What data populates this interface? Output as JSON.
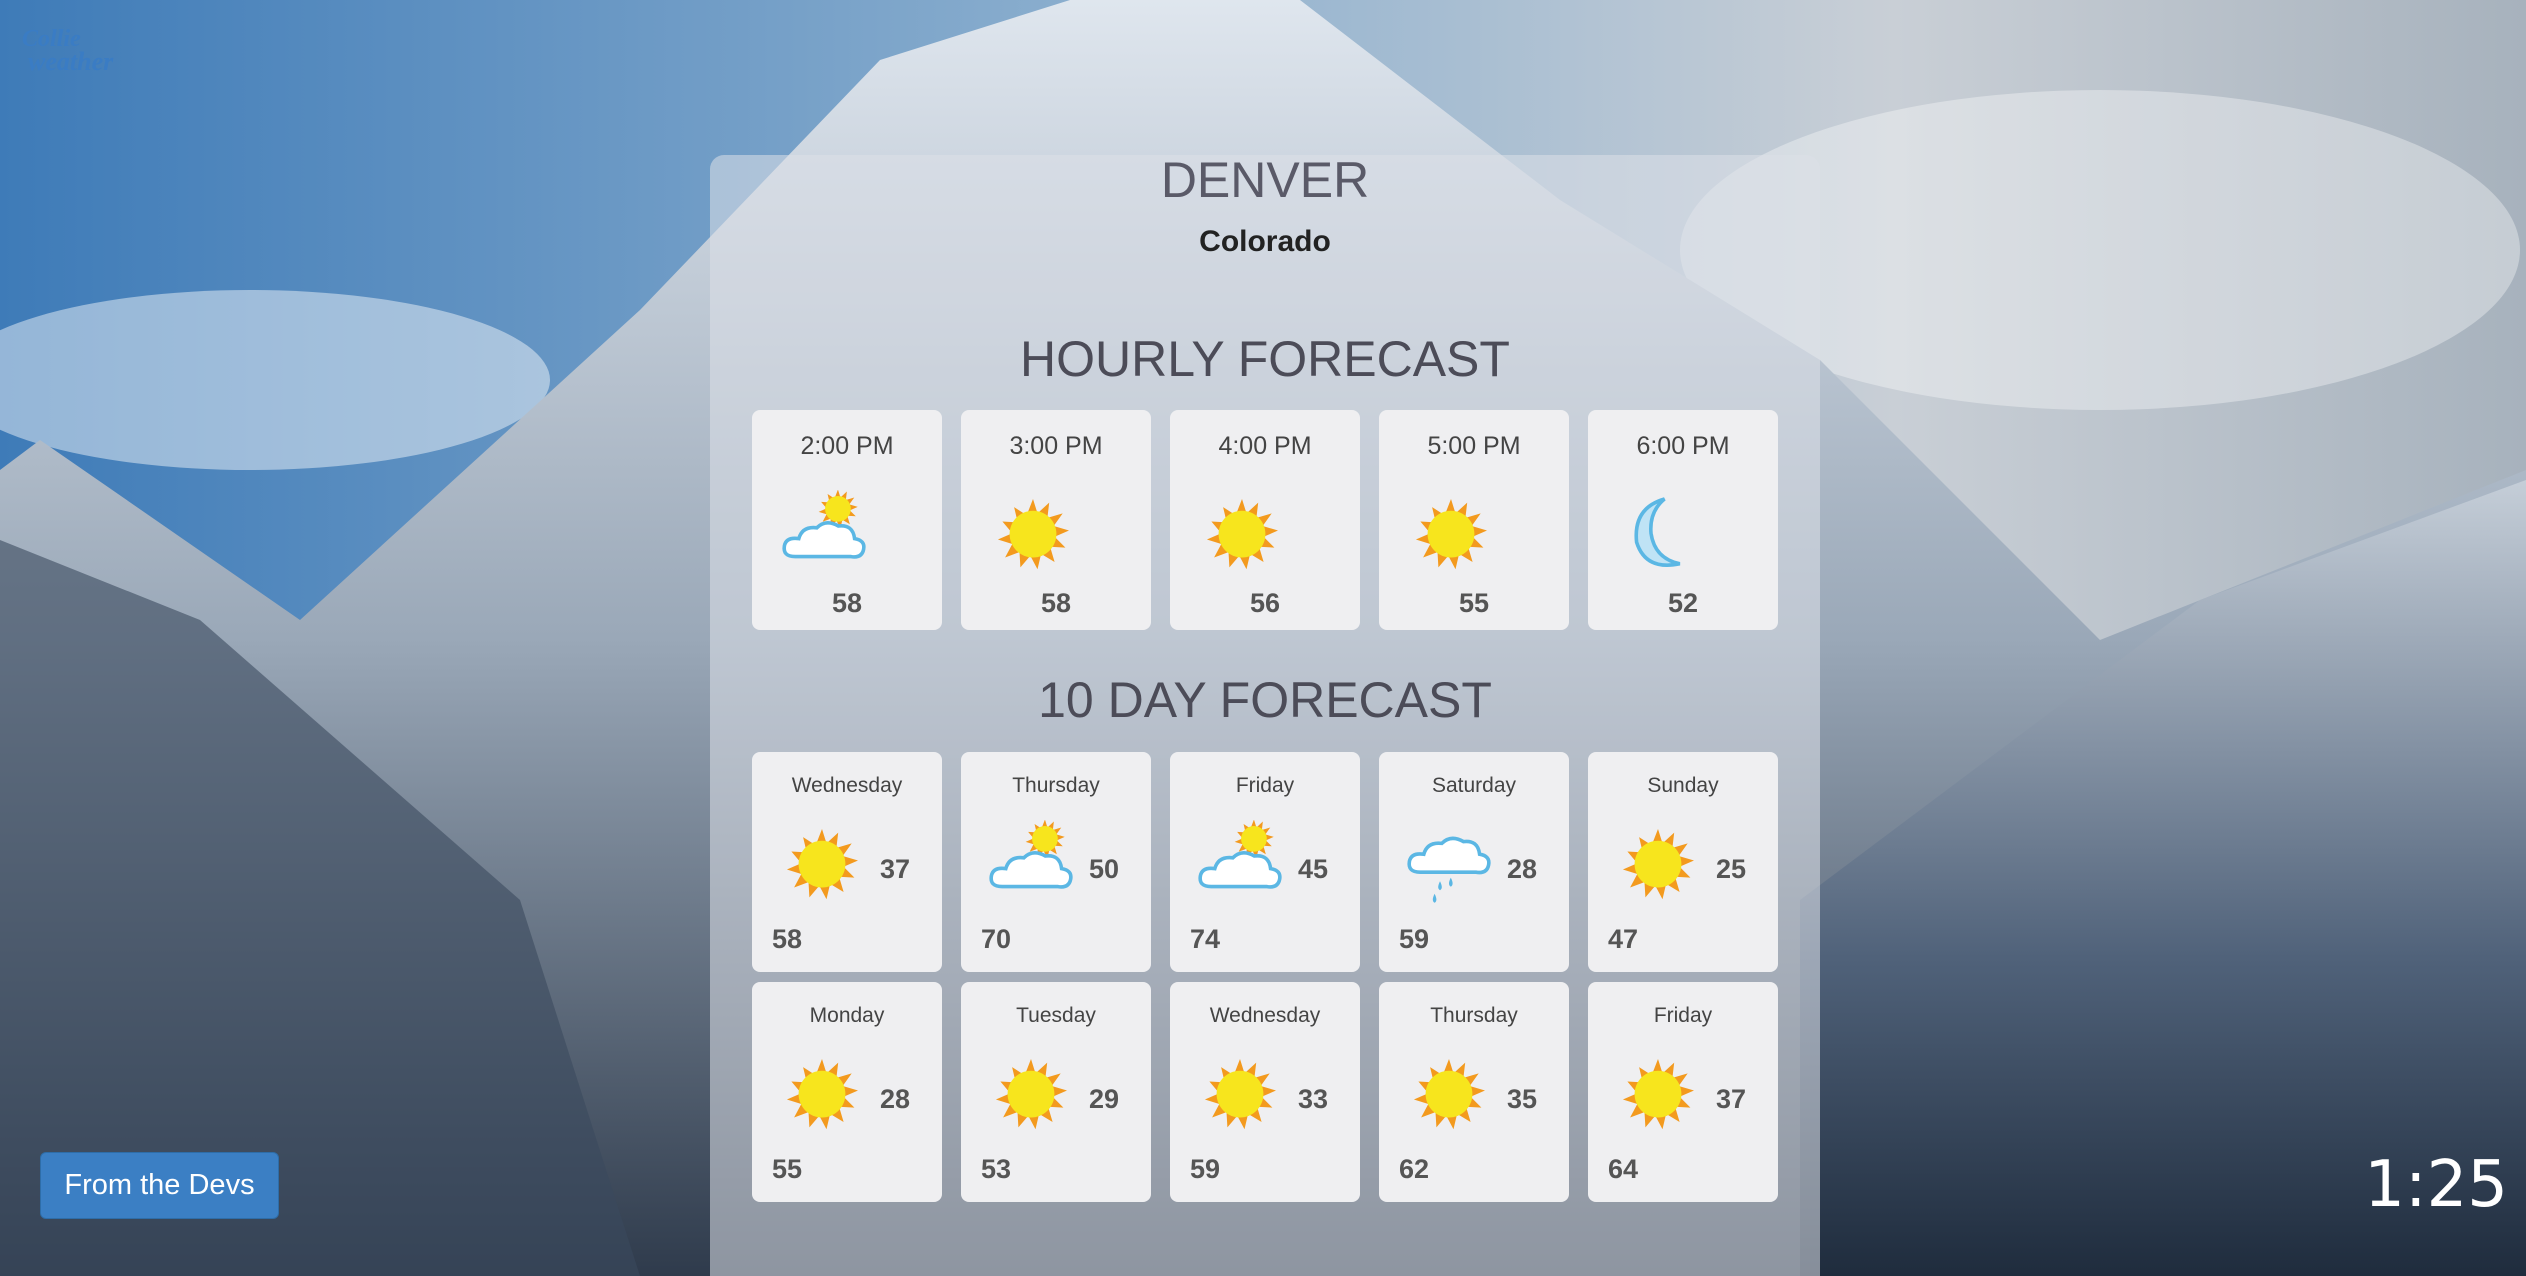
{
  "header": {
    "city": "DENVER",
    "region": "Colorado"
  },
  "hourly": {
    "title": "HOURLY FORECAST",
    "items": [
      {
        "time": "2:00 PM",
        "icon": "partly-cloudy-icon",
        "temp": "58"
      },
      {
        "time": "3:00 PM",
        "icon": "sun-icon",
        "temp": "58"
      },
      {
        "time": "4:00 PM",
        "icon": "sun-icon",
        "temp": "56"
      },
      {
        "time": "5:00 PM",
        "icon": "sun-icon",
        "temp": "55"
      },
      {
        "time": "6:00 PM",
        "icon": "moon-icon",
        "temp": "52"
      }
    ]
  },
  "ten_day": {
    "title": "10 DAY FORECAST",
    "days": [
      {
        "day": "Wednesday",
        "icon": "sun-icon",
        "high": "37",
        "low": "58"
      },
      {
        "day": "Thursday",
        "icon": "partly-cloudy-icon",
        "high": "50",
        "low": "70"
      },
      {
        "day": "Friday",
        "icon": "partly-cloudy-icon",
        "high": "45",
        "low": "74"
      },
      {
        "day": "Saturday",
        "icon": "rain-cloud-icon",
        "high": "28",
        "low": "59"
      },
      {
        "day": "Sunday",
        "icon": "sun-icon",
        "high": "25",
        "low": "47"
      },
      {
        "day": "Monday",
        "icon": "sun-icon",
        "high": "28",
        "low": "55"
      },
      {
        "day": "Tuesday",
        "icon": "sun-icon",
        "high": "29",
        "low": "53"
      },
      {
        "day": "Wednesday",
        "icon": "sun-icon",
        "high": "33",
        "low": "59"
      },
      {
        "day": "Thursday",
        "icon": "sun-icon",
        "high": "35",
        "low": "62"
      },
      {
        "day": "Friday",
        "icon": "sun-icon",
        "high": "37",
        "low": "64"
      }
    ]
  },
  "footer": {
    "devs_label": "From the Devs",
    "clock": "1:25"
  },
  "colors": {
    "accent": "#3b7fc4",
    "sun": "#f7d51d",
    "cloud": "#7cc4e8"
  }
}
